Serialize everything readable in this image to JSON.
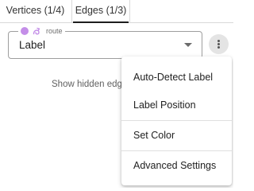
{
  "tabs": {
    "vertices_label": "Vertices (1/4)",
    "edges_label": "Edges (1/3)",
    "active": "edges"
  },
  "edge_select": {
    "legend_text": "route",
    "legend_dot_color": "#c48ee8",
    "legend_icon": "route-icon",
    "value": "Label"
  },
  "kebab_button": {
    "icon": "more-vert-icon"
  },
  "hint_text": "Show hidden edges",
  "menu": {
    "items": [
      {
        "label": "Auto-Detect Label"
      },
      {
        "label": "Label Position"
      },
      {
        "label": "Set Color"
      },
      {
        "label": "Advanced Settings"
      }
    ]
  }
}
